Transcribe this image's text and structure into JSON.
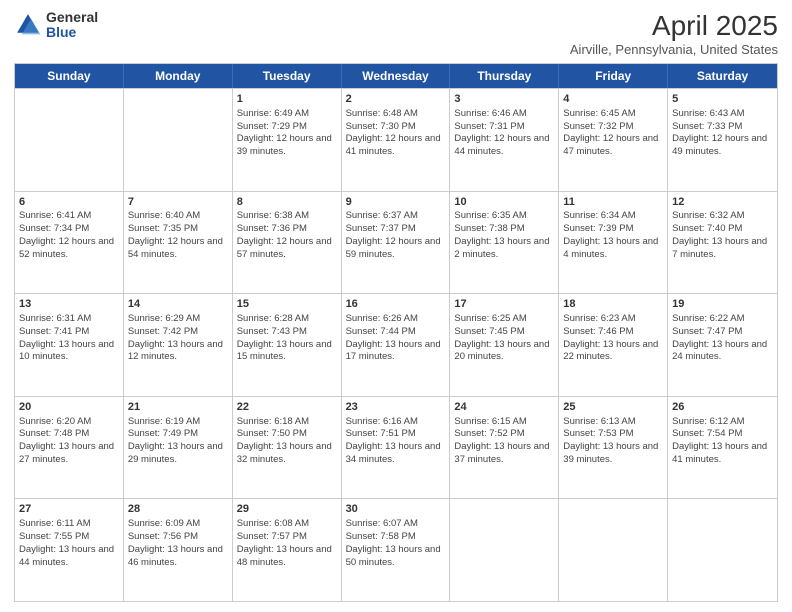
{
  "header": {
    "logo": {
      "general": "General",
      "blue": "Blue"
    },
    "title": "April 2025",
    "subtitle": "Airville, Pennsylvania, United States"
  },
  "weekdays": [
    "Sunday",
    "Monday",
    "Tuesday",
    "Wednesday",
    "Thursday",
    "Friday",
    "Saturday"
  ],
  "weeks": [
    [
      {
        "day": "",
        "info": ""
      },
      {
        "day": "",
        "info": ""
      },
      {
        "day": "1",
        "info": "Sunrise: 6:49 AM\nSunset: 7:29 PM\nDaylight: 12 hours and 39 minutes."
      },
      {
        "day": "2",
        "info": "Sunrise: 6:48 AM\nSunset: 7:30 PM\nDaylight: 12 hours and 41 minutes."
      },
      {
        "day": "3",
        "info": "Sunrise: 6:46 AM\nSunset: 7:31 PM\nDaylight: 12 hours and 44 minutes."
      },
      {
        "day": "4",
        "info": "Sunrise: 6:45 AM\nSunset: 7:32 PM\nDaylight: 12 hours and 47 minutes."
      },
      {
        "day": "5",
        "info": "Sunrise: 6:43 AM\nSunset: 7:33 PM\nDaylight: 12 hours and 49 minutes."
      }
    ],
    [
      {
        "day": "6",
        "info": "Sunrise: 6:41 AM\nSunset: 7:34 PM\nDaylight: 12 hours and 52 minutes."
      },
      {
        "day": "7",
        "info": "Sunrise: 6:40 AM\nSunset: 7:35 PM\nDaylight: 12 hours and 54 minutes."
      },
      {
        "day": "8",
        "info": "Sunrise: 6:38 AM\nSunset: 7:36 PM\nDaylight: 12 hours and 57 minutes."
      },
      {
        "day": "9",
        "info": "Sunrise: 6:37 AM\nSunset: 7:37 PM\nDaylight: 12 hours and 59 minutes."
      },
      {
        "day": "10",
        "info": "Sunrise: 6:35 AM\nSunset: 7:38 PM\nDaylight: 13 hours and 2 minutes."
      },
      {
        "day": "11",
        "info": "Sunrise: 6:34 AM\nSunset: 7:39 PM\nDaylight: 13 hours and 4 minutes."
      },
      {
        "day": "12",
        "info": "Sunrise: 6:32 AM\nSunset: 7:40 PM\nDaylight: 13 hours and 7 minutes."
      }
    ],
    [
      {
        "day": "13",
        "info": "Sunrise: 6:31 AM\nSunset: 7:41 PM\nDaylight: 13 hours and 10 minutes."
      },
      {
        "day": "14",
        "info": "Sunrise: 6:29 AM\nSunset: 7:42 PM\nDaylight: 13 hours and 12 minutes."
      },
      {
        "day": "15",
        "info": "Sunrise: 6:28 AM\nSunset: 7:43 PM\nDaylight: 13 hours and 15 minutes."
      },
      {
        "day": "16",
        "info": "Sunrise: 6:26 AM\nSunset: 7:44 PM\nDaylight: 13 hours and 17 minutes."
      },
      {
        "day": "17",
        "info": "Sunrise: 6:25 AM\nSunset: 7:45 PM\nDaylight: 13 hours and 20 minutes."
      },
      {
        "day": "18",
        "info": "Sunrise: 6:23 AM\nSunset: 7:46 PM\nDaylight: 13 hours and 22 minutes."
      },
      {
        "day": "19",
        "info": "Sunrise: 6:22 AM\nSunset: 7:47 PM\nDaylight: 13 hours and 24 minutes."
      }
    ],
    [
      {
        "day": "20",
        "info": "Sunrise: 6:20 AM\nSunset: 7:48 PM\nDaylight: 13 hours and 27 minutes."
      },
      {
        "day": "21",
        "info": "Sunrise: 6:19 AM\nSunset: 7:49 PM\nDaylight: 13 hours and 29 minutes."
      },
      {
        "day": "22",
        "info": "Sunrise: 6:18 AM\nSunset: 7:50 PM\nDaylight: 13 hours and 32 minutes."
      },
      {
        "day": "23",
        "info": "Sunrise: 6:16 AM\nSunset: 7:51 PM\nDaylight: 13 hours and 34 minutes."
      },
      {
        "day": "24",
        "info": "Sunrise: 6:15 AM\nSunset: 7:52 PM\nDaylight: 13 hours and 37 minutes."
      },
      {
        "day": "25",
        "info": "Sunrise: 6:13 AM\nSunset: 7:53 PM\nDaylight: 13 hours and 39 minutes."
      },
      {
        "day": "26",
        "info": "Sunrise: 6:12 AM\nSunset: 7:54 PM\nDaylight: 13 hours and 41 minutes."
      }
    ],
    [
      {
        "day": "27",
        "info": "Sunrise: 6:11 AM\nSunset: 7:55 PM\nDaylight: 13 hours and 44 minutes."
      },
      {
        "day": "28",
        "info": "Sunrise: 6:09 AM\nSunset: 7:56 PM\nDaylight: 13 hours and 46 minutes."
      },
      {
        "day": "29",
        "info": "Sunrise: 6:08 AM\nSunset: 7:57 PM\nDaylight: 13 hours and 48 minutes."
      },
      {
        "day": "30",
        "info": "Sunrise: 6:07 AM\nSunset: 7:58 PM\nDaylight: 13 hours and 50 minutes."
      },
      {
        "day": "",
        "info": ""
      },
      {
        "day": "",
        "info": ""
      },
      {
        "day": "",
        "info": ""
      }
    ]
  ]
}
